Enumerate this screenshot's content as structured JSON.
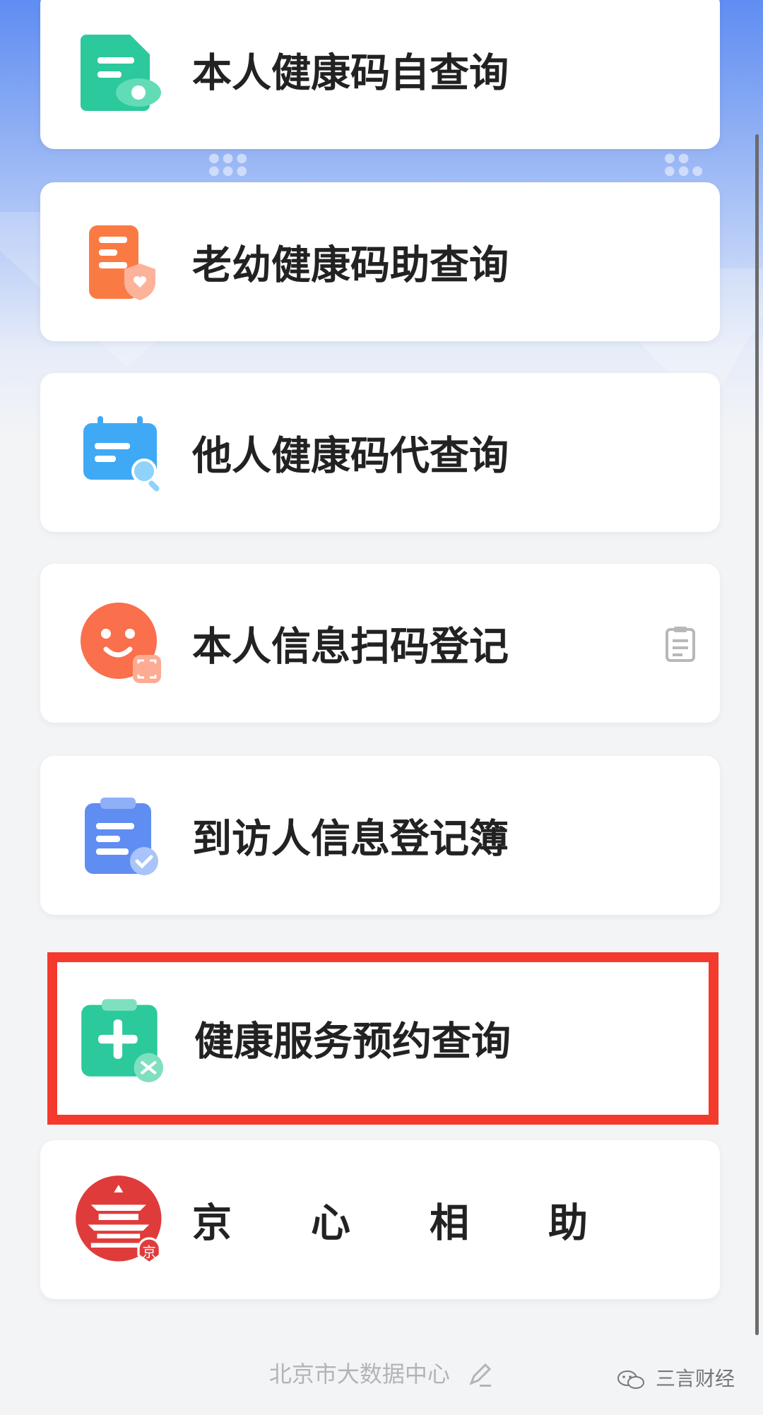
{
  "items": [
    {
      "label": "本人健康码自查询",
      "icon": "green-document-eye-icon"
    },
    {
      "label": "老幼健康码助查询",
      "icon": "orange-phone-shield-icon"
    },
    {
      "label": "他人健康码代查询",
      "icon": "blue-calendar-search-icon"
    },
    {
      "label": "本人信息扫码登记",
      "icon": "orange-smiley-scan-icon"
    },
    {
      "label": "到访人信息登记簿",
      "icon": "blue-clipboard-check-icon"
    },
    {
      "label": "健康服务预约查询",
      "icon": "green-medical-plus-icon"
    },
    {
      "label": "京　心　相　助",
      "icon": "red-temple-badge-icon"
    }
  ],
  "footer": {
    "text": "北京市大数据中心",
    "icon": "edit-pen-icon"
  },
  "watermark": {
    "text": "三言财经",
    "icon": "wechat-icon"
  },
  "colors": {
    "highlight": "#f43a2c",
    "accent_blue": "#5f8df2"
  }
}
